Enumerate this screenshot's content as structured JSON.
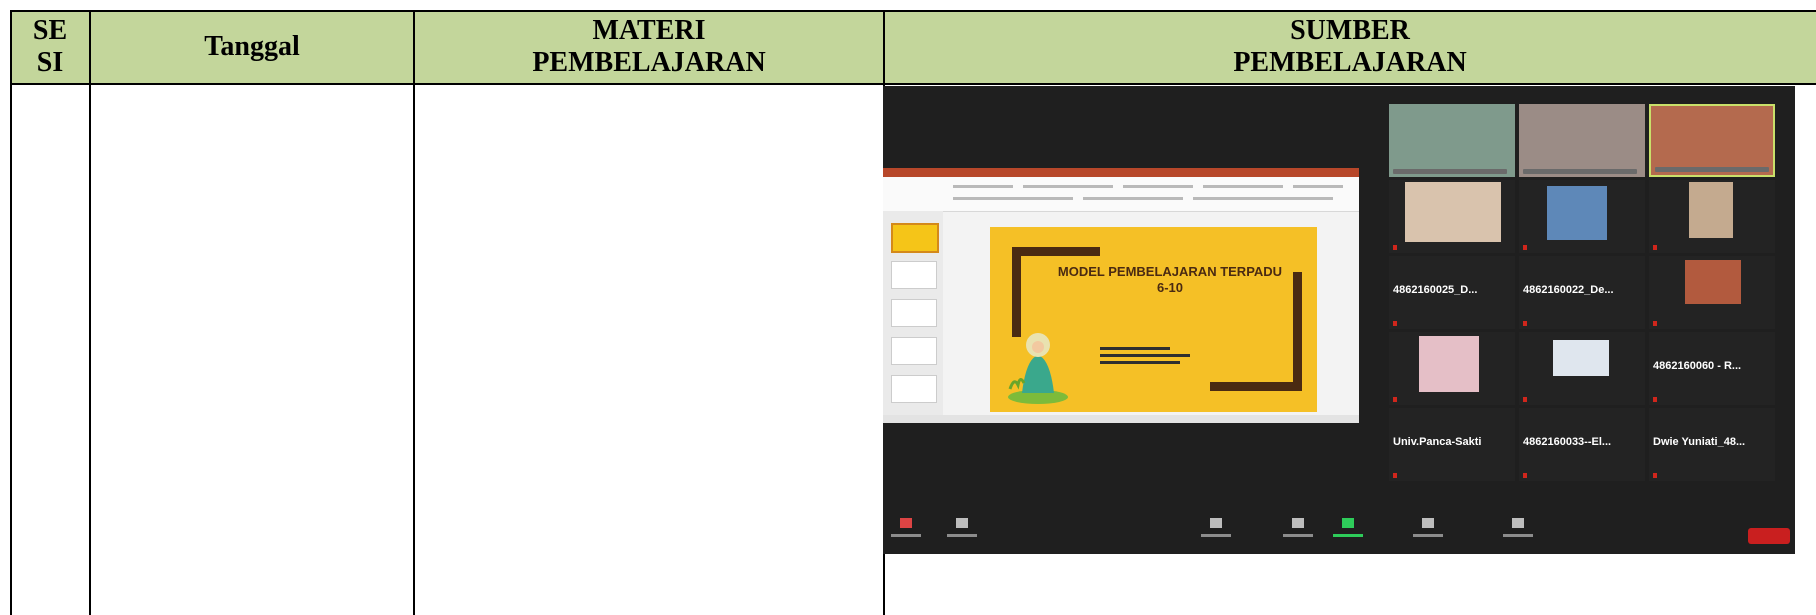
{
  "table": {
    "headers": {
      "sesi_line1": "SE",
      "sesi_line2": "SI",
      "tanggal": "Tanggal",
      "materi_line1": "MATERI",
      "materi_line2": "PEMBELAJARAN",
      "sumber_line1": "SUMBER",
      "sumber_line2": "PEMBELAJARAN"
    },
    "header_color": "#c3d69b"
  },
  "zoom_screenshot": {
    "slide": {
      "title_line1": "MODEL PEMBELAJARAN TERPADU",
      "title_line2": "6-10"
    },
    "participants": [
      {
        "label": "4862160025_D..."
      },
      {
        "label": "4862160022_De..."
      },
      {
        "label": "4862160060 - R..."
      },
      {
        "label": "Univ.Panca-Sakti"
      },
      {
        "label": "4862160033--El..."
      },
      {
        "label": "Dwie Yuniati_48..."
      }
    ],
    "end_button_color": "#c91f1f"
  }
}
